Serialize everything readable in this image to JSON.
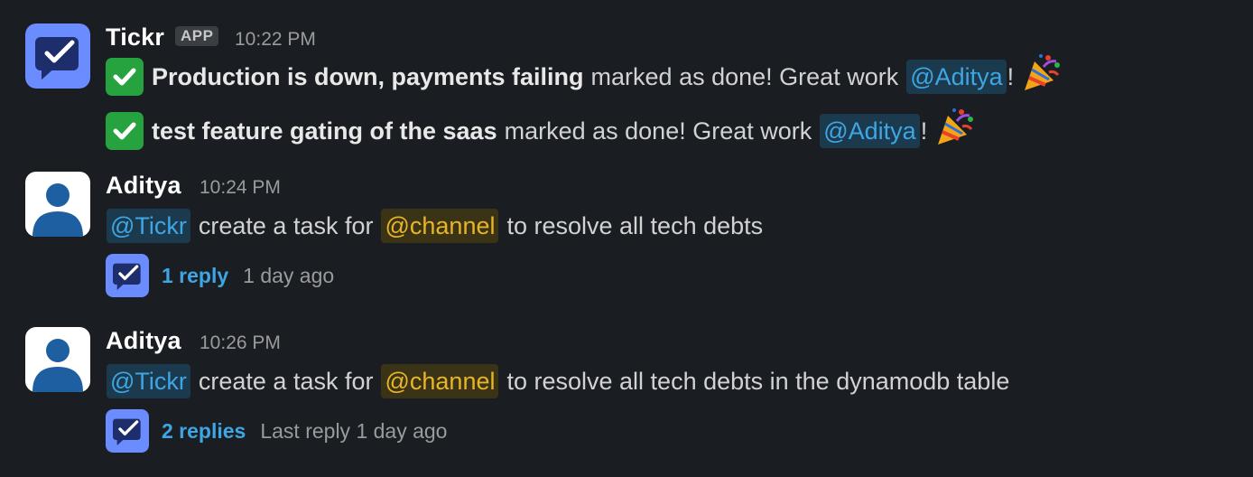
{
  "colors": {
    "background": "#1a1d21",
    "mention_bg": "#1c3a4d",
    "mention_fg": "#3ea6e4",
    "channel_bg": "#3b3315",
    "channel_fg": "#e8b528",
    "check_green": "#26a33f",
    "bot_avatar": "#6b8cff"
  },
  "messages": [
    {
      "author": "Tickr",
      "badge": "APP",
      "time": "10:22 PM",
      "avatar_icon": "tickr-bot-icon",
      "lines": [
        {
          "icon": "check-mark-icon",
          "bold": "Production is down, payments failing",
          "text": "marked as done! Great work",
          "mention": "@Aditya",
          "suffix": "!",
          "emoji": "party-popper-icon"
        },
        {
          "icon": "check-mark-icon",
          "bold": "test feature gating of the saas",
          "text": "marked as done! Great work",
          "mention": "@Aditya",
          "suffix": "!",
          "emoji": "party-popper-icon"
        }
      ]
    },
    {
      "author": "Aditya",
      "time": "10:24 PM",
      "avatar_icon": "user-silhouette-icon",
      "mention": "@Tickr",
      "text_a": "create a task for",
      "channel": "@channel",
      "text_b": "to resolve all tech debts",
      "thread": {
        "count": "1 reply",
        "when": "1 day ago"
      }
    },
    {
      "author": "Aditya",
      "time": "10:26 PM",
      "avatar_icon": "user-silhouette-icon",
      "mention": "@Tickr",
      "text_a": "create a task for",
      "channel": "@channel",
      "text_b": "to resolve all tech debts in the dynamodb table",
      "thread": {
        "count": "2 replies",
        "when": "Last reply 1 day ago"
      }
    }
  ]
}
